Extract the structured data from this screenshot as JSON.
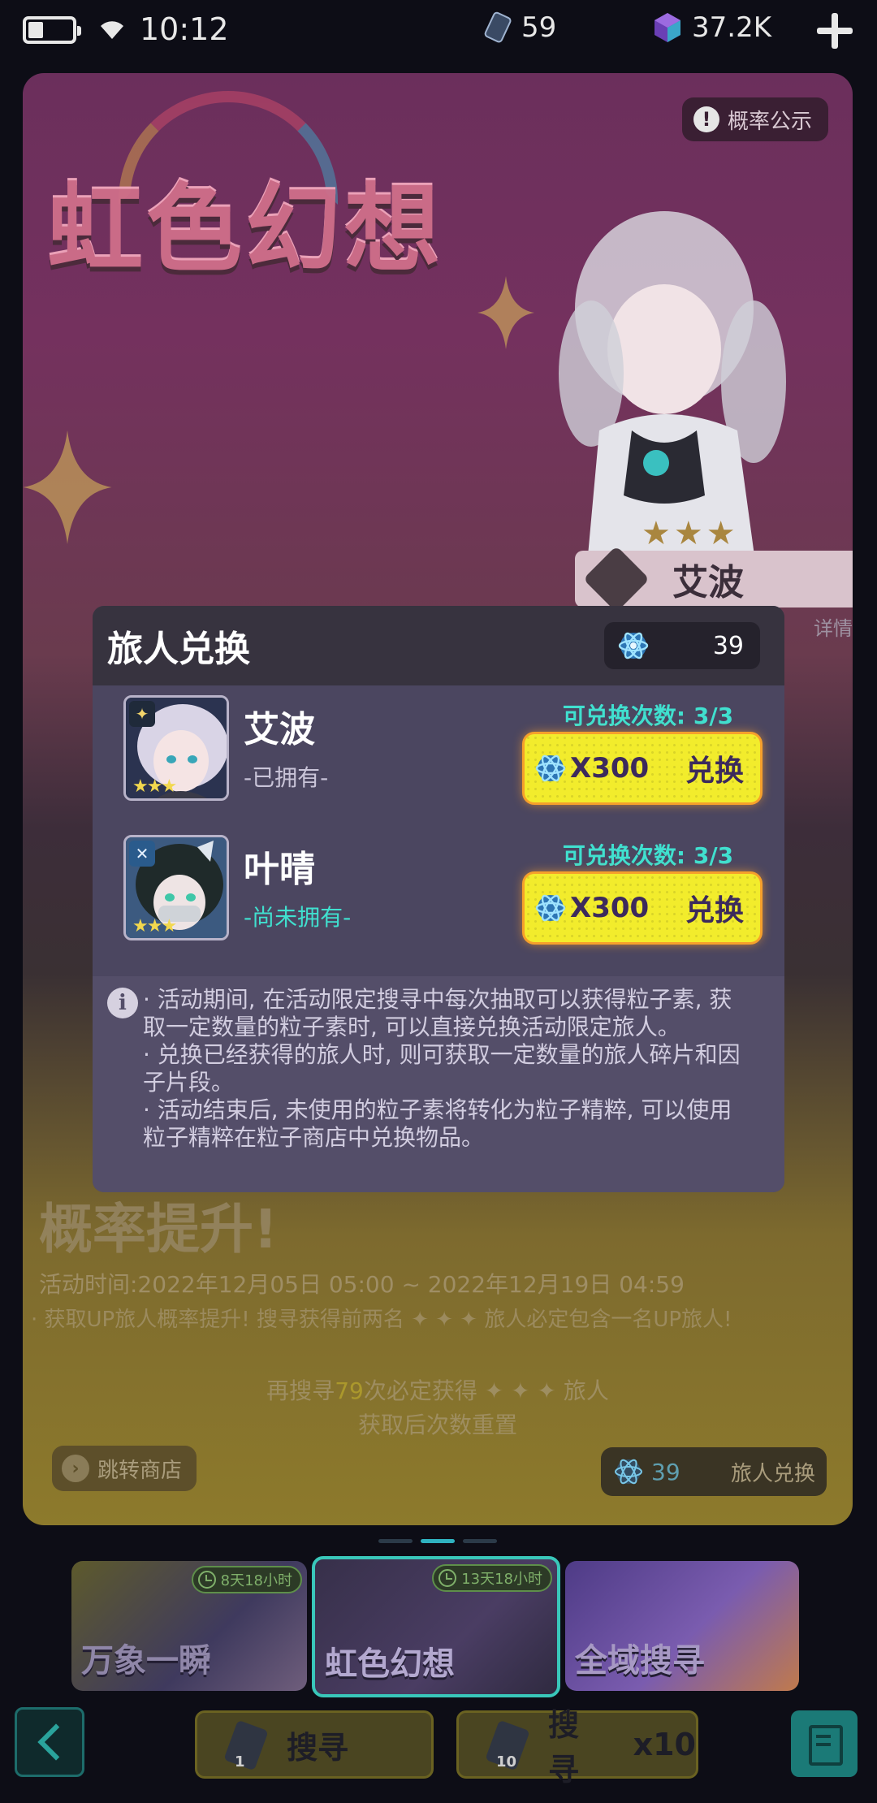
{
  "status_bar": {
    "time": "10:12",
    "tickets": "59",
    "gems": "37.2K"
  },
  "banner": {
    "logo_text": "虹色幻想",
    "rate_button": "概率公示",
    "featured_name": "艾波",
    "featured_stars": "★★★",
    "detail_link": "详情",
    "rate_up_title": "概率提升!",
    "period": "活动时间:2022年12月05日 05:00 ~ 2022年12月19日 04:59",
    "rule": "· 获取UP旅人概率提升! 搜寻获得前两名 ✦ ✦ ✦ 旅人必定包含一名UP旅人!",
    "pity_prefix": "再搜寻",
    "pity_count": "79",
    "pity_suffix": "次必定获得 ✦ ✦ ✦ 旅人",
    "pity_line2": "获取后次数重置",
    "shop_button": "跳转商店",
    "exchange_button": {
      "count": "39",
      "label": "旅人兑换"
    }
  },
  "modal": {
    "title": "旅人兑换",
    "points": "39",
    "items": [
      {
        "name": "艾波",
        "status": "-已拥有-",
        "status_color": "#c9c4d8",
        "times": "可兑换次数: 3/3",
        "cost": "X300",
        "button": "兑换",
        "stars": "★★★"
      },
      {
        "name": "叶晴",
        "status": "-尚未拥有-",
        "status_color": "#40e0cf",
        "times": "可兑换次数: 3/3",
        "cost": "X300",
        "button": "兑换",
        "stars": "★★★"
      }
    ],
    "notice": [
      "· 活动期间, 在活动限定搜寻中每次抽取可以获得粒子素, 获取一定数量的粒子素时, 可以直接兑换活动限定旅人。",
      "· 兑换已经获得的旅人时, 则可获取一定数量的旅人碎片和因子片段。",
      "· 活动结束后, 未使用的粒子素将转化为粒子精粹, 可以使用粒子精粹在粒子商店中兑换物品。"
    ]
  },
  "tabs": [
    {
      "name": "万象一瞬",
      "timer": "8天18小时"
    },
    {
      "name": "虹色幻想",
      "timer": "13天18小时"
    },
    {
      "name": "全域搜寻",
      "timer": ""
    }
  ],
  "bottom": {
    "search_one": "搜寻",
    "search_one_count": "1",
    "search_ten": "搜寻",
    "search_ten_suffix": "x10",
    "search_ten_count": "10"
  },
  "colors": {
    "accent_teal": "#40e0cf",
    "redeem_yellow": "#f2ec2c",
    "modal_bg": "#4b4660"
  }
}
